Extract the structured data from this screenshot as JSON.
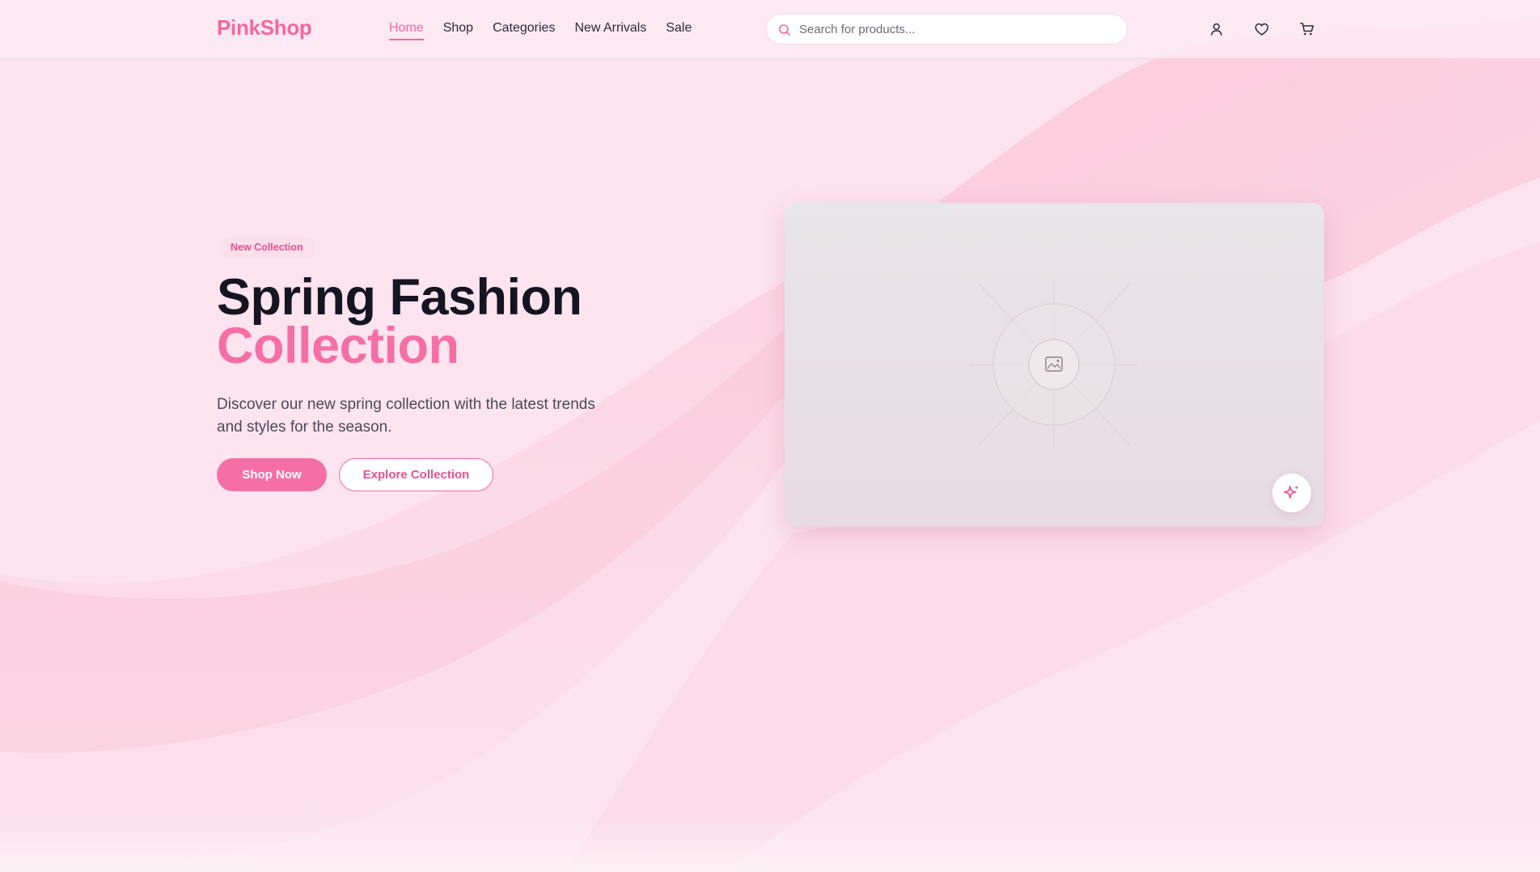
{
  "header": {
    "logo": "PinkShop",
    "nav": [
      {
        "label": "Home",
        "active": true
      },
      {
        "label": "Shop",
        "active": false
      },
      {
        "label": "Categories",
        "active": false
      },
      {
        "label": "New Arrivals",
        "active": false
      },
      {
        "label": "Sale",
        "active": false
      }
    ],
    "search": {
      "placeholder": "Search for products...",
      "value": "",
      "icon": "search-icon"
    },
    "icons": [
      "user-icon",
      "heart-icon",
      "cart-icon"
    ]
  },
  "hero": {
    "badge": "New Collection",
    "title_line1": "Spring Fashion",
    "title_line2": "Collection",
    "description": "Discover our new spring collection with the latest trends and styles for the season.",
    "primary_button": "Shop Now",
    "secondary_button": "Explore Collection",
    "image_icon": "image-placeholder-icon",
    "action_icon": "sparkle-icon"
  },
  "colors": {
    "accent": "#f56fa6",
    "background": "#fde4ef",
    "heading": "#151522"
  }
}
